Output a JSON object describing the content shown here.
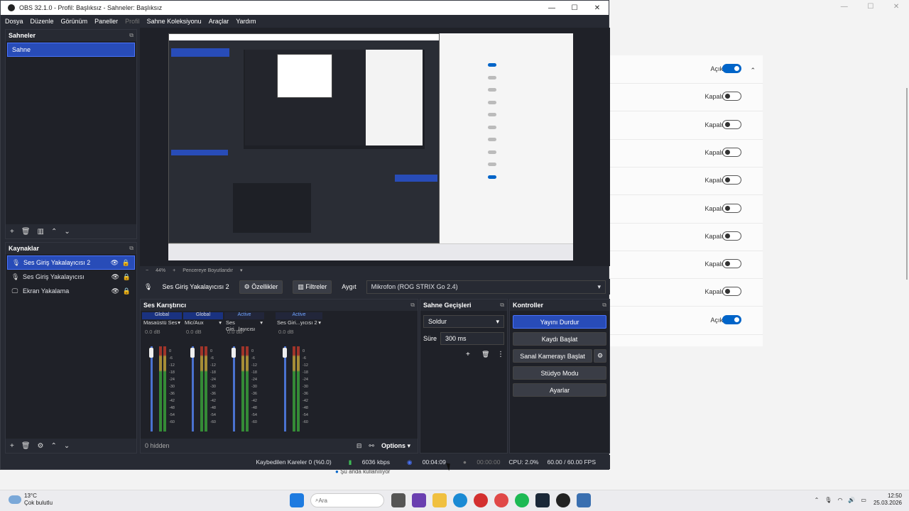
{
  "window": {
    "title": "OBS 32.1.0 - Profil: Başlıksız - Sahneler: Başlıksız"
  },
  "menu": [
    "Dosya",
    "Düzenle",
    "Görünüm",
    "Paneller",
    "Profil",
    "Sahne Koleksiyonu",
    "Araçlar",
    "Yardım"
  ],
  "scenes": {
    "title": "Sahneler",
    "items": [
      "Sahne"
    ]
  },
  "sources": {
    "title": "Kaynaklar",
    "items": [
      {
        "label": "Ses Giriş Yakalayıcısı 2",
        "icon": "mic-icon",
        "selected": true
      },
      {
        "label": "Ses Giriş Yakalayıcısı",
        "icon": "mic-icon",
        "selected": false
      },
      {
        "label": "Ekran Yakalama",
        "icon": "monitor-icon",
        "selected": false
      }
    ]
  },
  "preview": {
    "zoom": "44%",
    "fit_label": "Pencereye Boyutlandır"
  },
  "context_bar": {
    "source": "Ses Giriş Yakalayıcısı 2",
    "properties": "Özellikler",
    "filters": "Filtreler",
    "device_label": "Aygıt",
    "device_value": "Mikrofon (ROG STRIX Go 2.4)"
  },
  "mixer": {
    "title": "Ses Karıştırıcı",
    "channels": [
      {
        "header": "Global",
        "name": "Masaüstü Ses",
        "db": "0.0 dB"
      },
      {
        "header": "Global",
        "name": "Mic/Aux",
        "db": "0.0 dB"
      },
      {
        "header": "Active",
        "name": "Ses Giri...layıcısı",
        "db": "0.0 dB"
      },
      {
        "header": "Active",
        "name": "Ses Giri...yıcısı 2",
        "db": "0.0 dB"
      }
    ],
    "scale": [
      "0",
      "-6",
      "-12",
      "-18",
      "-24",
      "-30",
      "-36",
      "-42",
      "-48",
      "-54",
      "-60"
    ],
    "hidden": "0 hidden",
    "options": "Options"
  },
  "transitions": {
    "title": "Sahne Geçişleri",
    "type": "Soldur",
    "duration_label": "Süre",
    "duration_value": "300 ms"
  },
  "controls": {
    "title": "Kontroller",
    "buttons": [
      "Yayını Durdur",
      "Kaydı Başlat",
      "Sanal Kamerayı Başlat",
      "Stüdyo Modu",
      "Ayarlar"
    ]
  },
  "status": {
    "dropped": "Kaybedilen Kareler 0 (%0.0)",
    "bitrate": "6036 kbps",
    "stream_time": "00:04:09",
    "rec_time": "00:00:00",
    "cpu": "CPU: 2.0%",
    "fps": "60.00 / 60.00 FPS"
  },
  "background_note": "Şu anda kullanılıyor",
  "settings_toggles": [
    {
      "label": "Açık",
      "on": true
    },
    {
      "label": "Kapalı",
      "on": false
    },
    {
      "label": "Kapalı",
      "on": false
    },
    {
      "label": "Kapalı",
      "on": false
    },
    {
      "label": "Kapalı",
      "on": false
    },
    {
      "label": "Kapalı",
      "on": false
    },
    {
      "label": "Kapalı",
      "on": false
    },
    {
      "label": "Kapalı",
      "on": false
    },
    {
      "label": "Kapalı",
      "on": false
    },
    {
      "label": "Açık",
      "on": true
    }
  ],
  "taskbar": {
    "weather_temp": "13°C",
    "weather_desc": "Çok bulutlu",
    "search_placeholder": "Ara",
    "time": "12:50",
    "date": "25.03.2026"
  }
}
